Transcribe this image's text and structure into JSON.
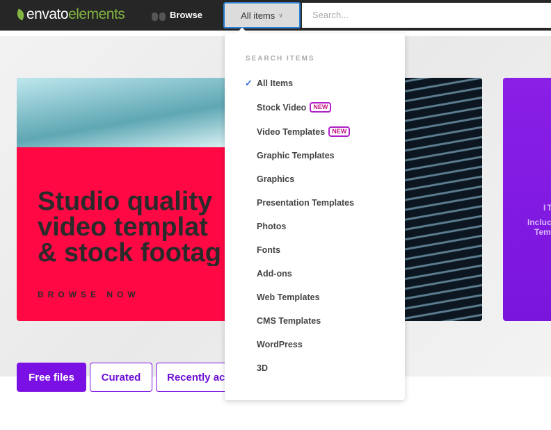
{
  "header": {
    "logo_part1": "envato",
    "logo_part2": "elements",
    "browse": "Browse",
    "category_select": "All items",
    "search_placeholder": "Search..."
  },
  "hero": {
    "headline_lines": [
      "Studio quality",
      "video templat",
      "& stock footag"
    ],
    "cta": "BROWSE NOW",
    "side_card_lines": [
      "IT",
      "Incluc",
      "Tem"
    ]
  },
  "filters": [
    "Free files",
    "Curated",
    "Recently ac"
  ],
  "dropdown": {
    "heading": "SEARCH ITEMS",
    "badge": "NEW",
    "items": [
      {
        "label": "All Items",
        "selected": true,
        "new": false
      },
      {
        "label": "Stock Video",
        "new": true
      },
      {
        "label": "Video Templates",
        "new": true
      },
      {
        "label": "Graphic Templates"
      },
      {
        "label": "Graphics"
      },
      {
        "label": "Presentation Templates"
      },
      {
        "label": "Photos"
      },
      {
        "label": "Fonts"
      },
      {
        "label": "Add-ons"
      },
      {
        "label": "Web Templates"
      },
      {
        "label": "CMS Templates"
      },
      {
        "label": "WordPress"
      },
      {
        "label": "3D"
      }
    ]
  },
  "colors": {
    "brand_green": "#82b541",
    "accent_purple": "#7a10e3",
    "hero_red": "#ff0844",
    "focus_blue": "#2d7fd1"
  }
}
